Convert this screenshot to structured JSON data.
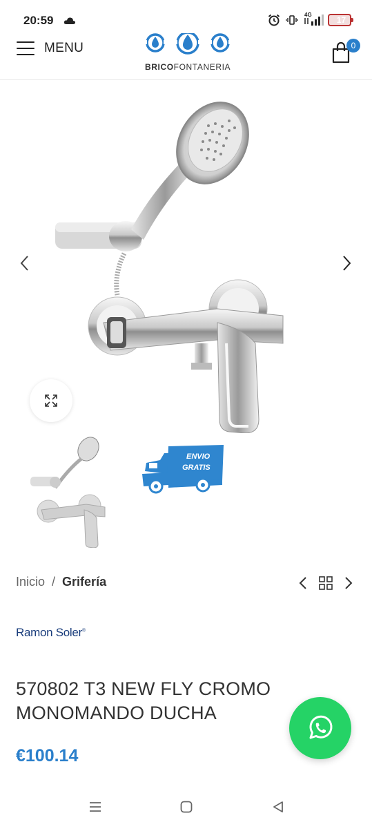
{
  "status_bar": {
    "time": "20:59",
    "network": "4G",
    "battery": "17",
    "battery_level_percent": 17,
    "icons": [
      "cloud-icon",
      "alarm-icon",
      "vibrate-icon",
      "signal-icon",
      "battery-icon"
    ]
  },
  "header": {
    "menu_label": "MENU",
    "logo_bold": "BRICO",
    "logo_rest": "FONTANERIA",
    "cart_count": "0"
  },
  "gallery": {
    "main_image": "shower-mixer-with-hand-shower",
    "thumbnails": [
      "shower-mixer-thumbnail",
      "envio-gratis-truck"
    ],
    "envio_line1": "ENVIO",
    "envio_line2": "GRATIS"
  },
  "breadcrumb": {
    "home": "Inicio",
    "separator": "/",
    "current": "Grifería"
  },
  "product": {
    "brand": "Ramon Soler",
    "brand_mark": "®",
    "title": "570802 T3 NEW FLY CROMO MONOMANDO DUCHA",
    "price": "€100.14"
  },
  "colors": {
    "accent": "#2a7fcb",
    "brand": "#1a3d7c",
    "whatsapp": "#25d366",
    "truck": "#2f86cf"
  }
}
